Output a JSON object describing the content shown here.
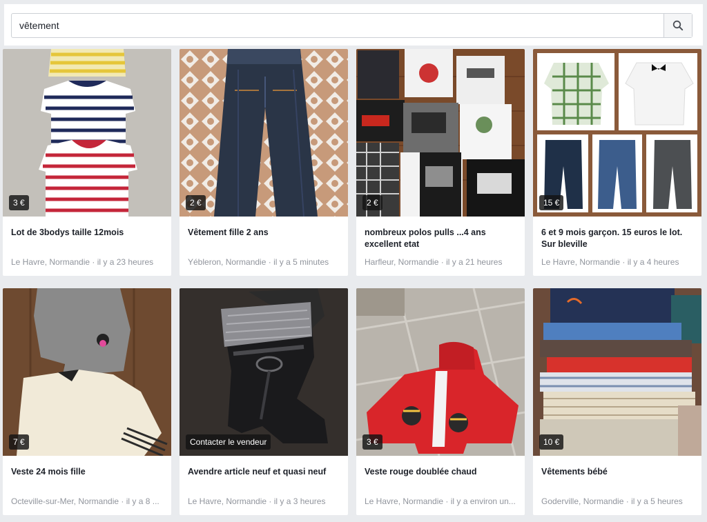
{
  "search": {
    "value": "vêtement",
    "button_icon": "search-icon"
  },
  "listings": [
    {
      "title": "Lot de 3bodys taille 12mois",
      "price": "3 €",
      "location": "Le Havre, Normandie",
      "time": "il y a 23 heures"
    },
    {
      "title": "Vêtement fille 2 ans",
      "price": "2 €",
      "location": "Yébleron, Normandie",
      "time": "il y a 5 minutes"
    },
    {
      "title": "nombreux polos pulls ...4 ans excellent etat",
      "price": "2 €",
      "location": "Harfleur, Normandie",
      "time": "il y a 21 heures"
    },
    {
      "title": "6 et 9 mois garçon. 15 euros le lot. Sur bleville",
      "price": "15 €",
      "location": "Le Havre, Normandie",
      "time": "il y a 4 heures"
    },
    {
      "title": "Veste 24 mois fille",
      "price": "7 €",
      "location": "Octeville-sur-Mer, Normandie",
      "time": "il y a 8 ..."
    },
    {
      "title": "Avendre article neuf et quasi neuf",
      "price": "Contacter le vendeur",
      "location": "Le Havre, Normandie",
      "time": "il y a 3 heures"
    },
    {
      "title": "Veste rouge doublée chaud",
      "price": "3 €",
      "location": "Le Havre, Normandie",
      "time": "il y a environ un..."
    },
    {
      "title": "Vêtements bébé",
      "price": "10 €",
      "location": "Goderville, Normandie",
      "time": "il y a 5 heures"
    }
  ],
  "meta_separator": " · "
}
